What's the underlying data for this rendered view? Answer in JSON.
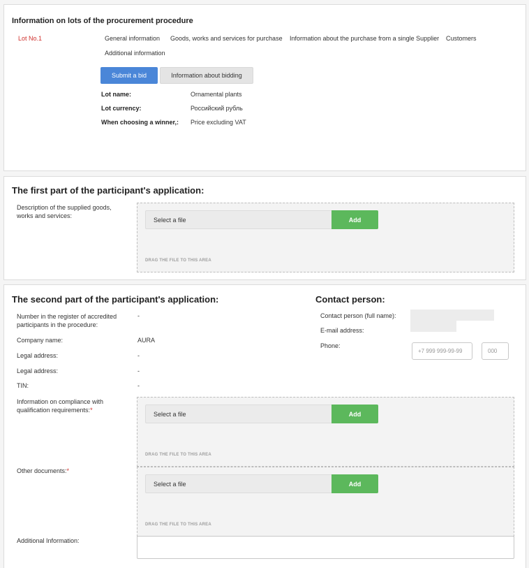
{
  "lots": {
    "title": "Information on lots of the procurement procedure",
    "lot_label": "Lot No.1",
    "tabs": [
      "General information",
      "Goods, works and services for purchase",
      "Information about the purchase from a single Supplier",
      "Customers",
      "Additional information"
    ],
    "submit_button": "Submit a bid",
    "bidding_button": "Information about bidding",
    "fields": [
      {
        "label": "Lot name:",
        "value": "Ornamental plants"
      },
      {
        "label": "Lot currency:",
        "value": "Российский рубль"
      },
      {
        "label": "When choosing a winner,:",
        "value": "Price excluding VAT"
      }
    ]
  },
  "first_part": {
    "title": "The first part of the participant's application:",
    "description_label": "Description of the supplied goods, works and services:"
  },
  "file_upload": {
    "select_label": "Select a file",
    "add_label": "Add",
    "drag_hint": "DRAG THE FILE TO THIS AREA"
  },
  "second_part": {
    "title": "The second part of the participant's application:",
    "rows": [
      {
        "label": "Number in the register of accredited participants in the procedure:",
        "value": "-"
      },
      {
        "label": "Company name:",
        "value": "AURA"
      },
      {
        "label": "Legal address:",
        "value": "-"
      },
      {
        "label": "Legal address:",
        "value": "-"
      },
      {
        "label": "TIN:",
        "value": "-"
      }
    ],
    "qualification_label": "Information on compliance with qualification requirements:",
    "other_docs_label": "Other documents:",
    "required_mark": "*",
    "additional_label": "Additional Information:"
  },
  "contact": {
    "title": "Contact person:",
    "name_label": "Contact person (full name):",
    "email_label": "E-mail address:",
    "phone_label": "Phone:",
    "phone_placeholder": "+7 999 999-99-99",
    "ext_placeholder": "000"
  }
}
